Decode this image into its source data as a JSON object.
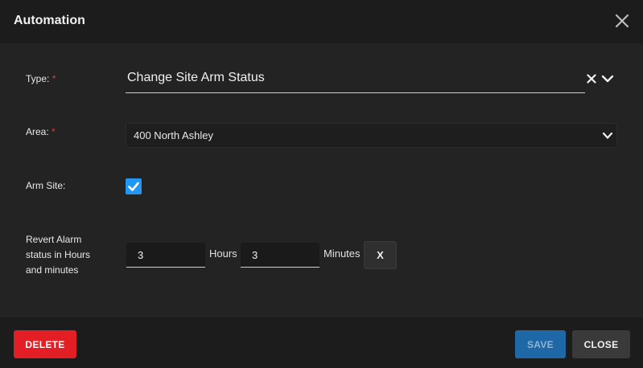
{
  "dialog": {
    "title": "Automation"
  },
  "form": {
    "type": {
      "label": "Type:",
      "required_mark": "*",
      "value": "Change Site Arm Status"
    },
    "area": {
      "label": "Area:",
      "required_mark": "*",
      "value": "400 North Ashley"
    },
    "arm_site": {
      "label": "Arm Site:",
      "checked": true
    },
    "revert": {
      "label_line1": "Revert Alarm",
      "label_line2": "status in Hours",
      "label_line3": "and minutes",
      "hours_value": "3",
      "hours_unit": "Hours",
      "minutes_value": "3",
      "minutes_unit": "Minutes",
      "clear_label": "X"
    }
  },
  "footer": {
    "delete_label": "DELETE",
    "save_label": "SAVE",
    "close_label": "CLOSE"
  },
  "colors": {
    "accent": "#2196f3",
    "danger": "#e31e24",
    "primary": "#1f68a8",
    "required": "#e53935"
  }
}
